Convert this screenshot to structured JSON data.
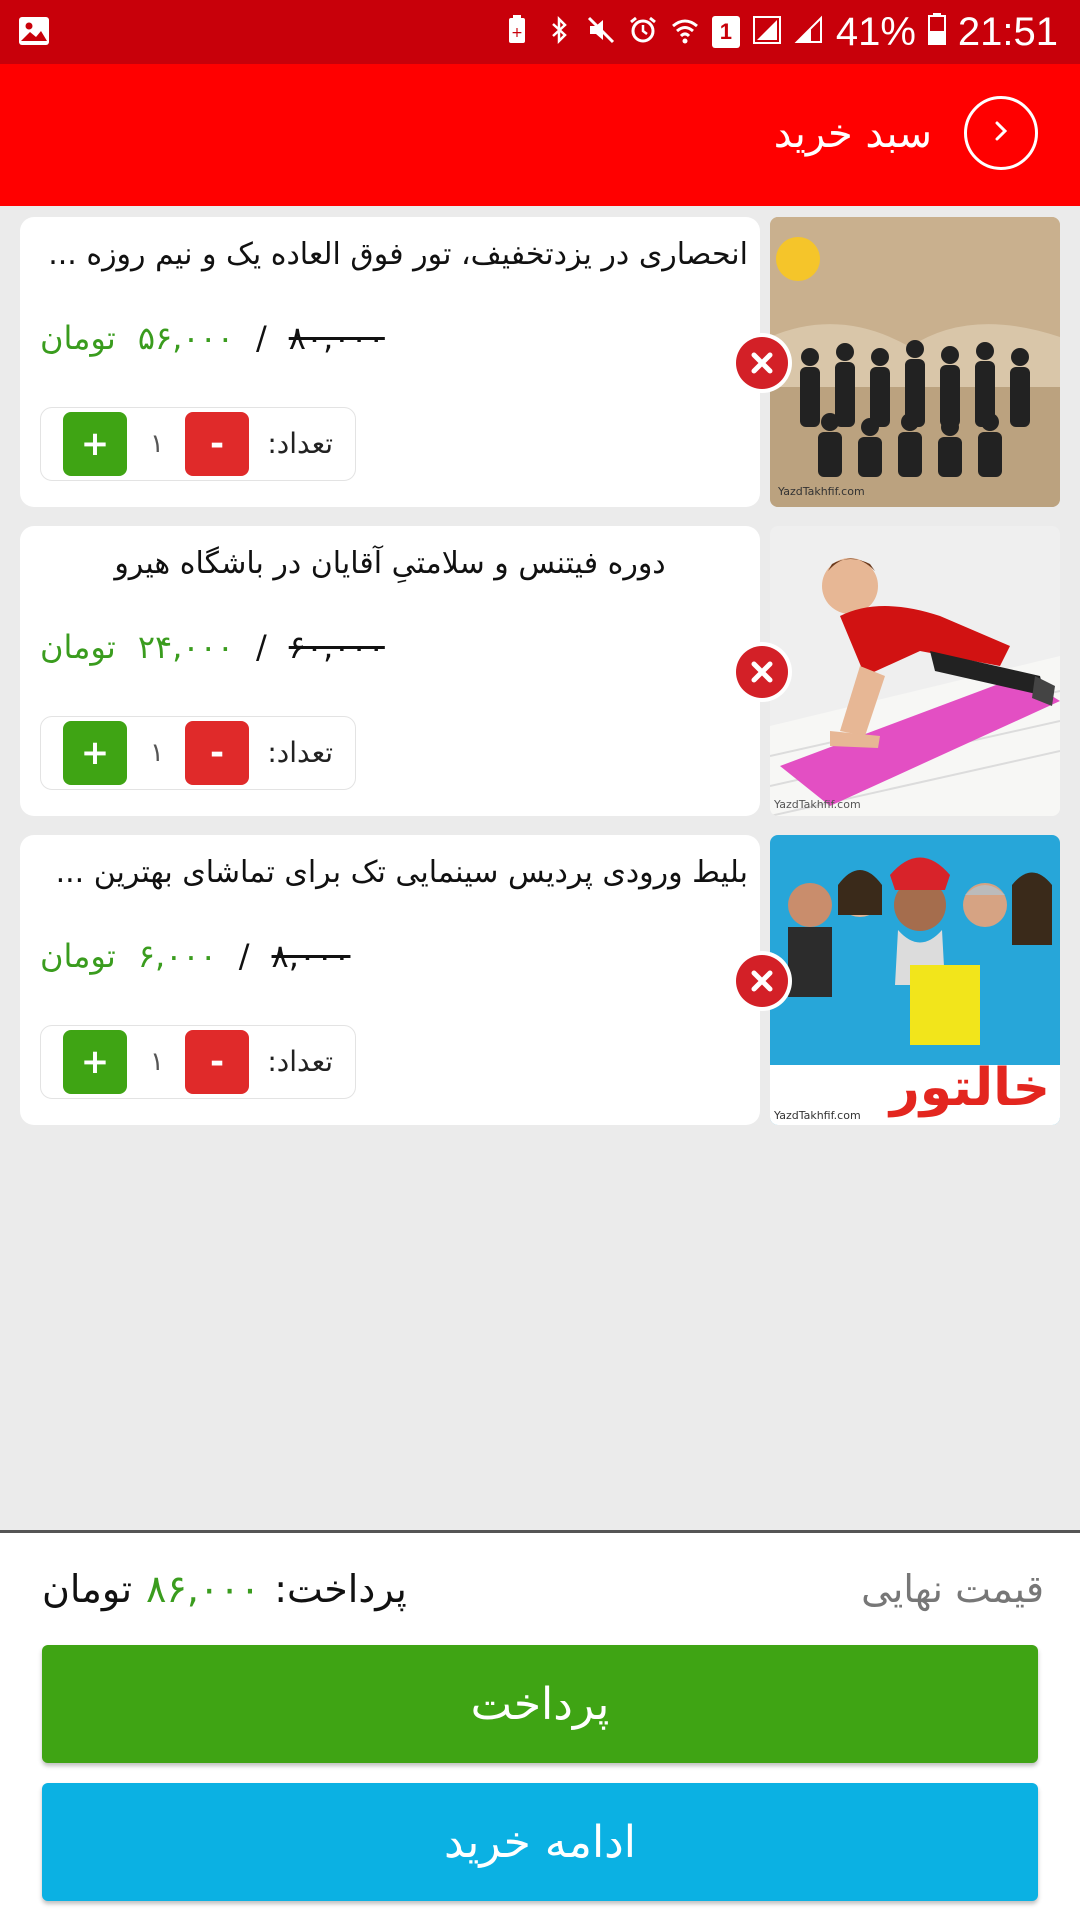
{
  "status_bar": {
    "battery": "41%",
    "time": "21:51",
    "sim": "1"
  },
  "header": {
    "title": "سبد خرید",
    "back_icon": "chevron-right-icon"
  },
  "cart": {
    "items": [
      {
        "title": "انحصاری در یزدتخفیف، تور فوق العاده یک و نیم روزه ...",
        "old_price": "۸۰,۰۰۰",
        "new_price": "۵۶,۰۰۰",
        "currency": "تومان",
        "separator": "/",
        "qty_label": "تعداد:",
        "qty": "۱",
        "plus": "+",
        "minus": "-",
        "image_watermark": "YazdTakhfif.com"
      },
      {
        "title": "دوره فیتنس و سلامتیِ آقایان در باشگاه هیرو",
        "old_price": "۶۰,۰۰۰",
        "new_price": "۲۴,۰۰۰",
        "currency": "تومان",
        "separator": "/",
        "qty_label": "تعداد:",
        "qty": "۱",
        "plus": "+",
        "minus": "-",
        "image_watermark": "YazdTakhfif.com"
      },
      {
        "title": "بلیط ورودی پردیس سینمایی تک برای تماشای بهترین ...",
        "old_price": "۸,۰۰۰",
        "new_price": "۶,۰۰۰",
        "currency": "تومان",
        "separator": "/",
        "qty_label": "تعداد:",
        "qty": "۱",
        "plus": "+",
        "minus": "-",
        "image_watermark": "YazdTakhfif.com",
        "image_caption": "خالتور"
      }
    ]
  },
  "footer": {
    "final_label": "قیمت نهایی",
    "pay_label": "پرداخت:",
    "pay_amount": "۸۶,۰۰۰",
    "pay_currency": "تومان",
    "pay_button": "پرداخت",
    "continue_button": "ادامه خرید"
  },
  "colors": {
    "status_bar": "#c8000a",
    "app_bar": "#ff0000",
    "price_green": "#3a9c1e",
    "pay_button": "#3fa414",
    "continue_button": "#0bb1e3",
    "remove_red": "#d32027"
  }
}
